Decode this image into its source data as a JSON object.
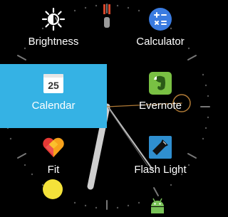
{
  "apps": [
    {
      "label": "Brightness",
      "icon": "brightness-icon"
    },
    {
      "label": "Calculator",
      "icon": "calculator-icon"
    },
    {
      "label": "Calendar",
      "icon": "calendar-icon",
      "badge": "25",
      "selected": true
    },
    {
      "label": "Evernote",
      "icon": "evernote-icon"
    },
    {
      "label": "Fit",
      "icon": "fit-heart-icon"
    },
    {
      "label": "Flash Light",
      "icon": "flashlight-icon"
    }
  ],
  "partially_visible": [
    {
      "icon": "yellow-circle-icon"
    },
    {
      "icon": "android-icon"
    }
  ],
  "colors": {
    "selected_tile": "#35b2e4",
    "calculator": "#3a7be0",
    "evernote": "#79c043",
    "flashlight": "#2f8fd0",
    "android": "#78c257",
    "yellow": "#f4e23a"
  }
}
